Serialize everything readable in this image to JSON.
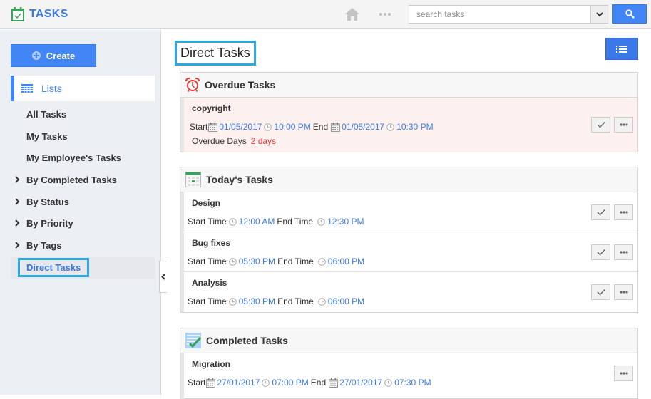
{
  "app": {
    "title": "TASKS",
    "brand_color": "#3b78e7",
    "accent_color": "#4285f4",
    "highlight_color": "#29a9e0"
  },
  "topbar": {
    "icons": [
      "home-icon",
      "more-dots-icon",
      "chevron-down-icon",
      "search-icon"
    ],
    "search_placeholder": "search tasks",
    "search_value": ""
  },
  "sidebar": {
    "create_label": "Create",
    "lists_label": "Lists",
    "items": [
      {
        "label": "All Tasks",
        "expandable": false
      },
      {
        "label": "My Tasks",
        "expandable": false
      },
      {
        "label": "My Employee's Tasks",
        "expandable": false
      },
      {
        "label": "By Completed Tasks",
        "expandable": true
      },
      {
        "label": "By Status",
        "expandable": true
      },
      {
        "label": "By Priority",
        "expandable": true
      },
      {
        "label": "By Tags",
        "expandable": true
      },
      {
        "label": "Direct Tasks",
        "expandable": false,
        "active": true
      }
    ]
  },
  "main": {
    "title": "Direct Tasks",
    "sections": {
      "overdue": {
        "title": "Overdue Tasks",
        "tasks": [
          {
            "name": "copyright",
            "start_label": "Start",
            "start_date": "01/05/2017",
            "start_time": "10:00 PM",
            "end_label": "End",
            "end_date": "01/05/2017",
            "end_time": "10:30 PM",
            "overdue_label": "Overdue Days",
            "overdue_value": "2 days"
          }
        ]
      },
      "today": {
        "title": "Today's Tasks",
        "tasks": [
          {
            "name": "Design",
            "start_label": "Start Time",
            "start_time": "12:00 AM",
            "end_label": "End Time",
            "end_time": "12:30 PM"
          },
          {
            "name": "Bug fixes",
            "start_label": "Start Time",
            "start_time": "05:30 PM",
            "end_label": "End Time",
            "end_time": "06:00 PM"
          },
          {
            "name": "Analysis",
            "start_label": "Start Time",
            "start_time": "05:30 PM",
            "end_label": "End Time",
            "end_time": "06:00 PM"
          }
        ]
      },
      "completed": {
        "title": "Completed Tasks",
        "tasks": [
          {
            "name": "Migration",
            "start_label": "Start",
            "start_date": "27/01/2017",
            "start_time": "07:00 PM",
            "end_label": "End",
            "end_date": "27/01/2017",
            "end_time": "07:30 PM"
          }
        ]
      }
    }
  }
}
